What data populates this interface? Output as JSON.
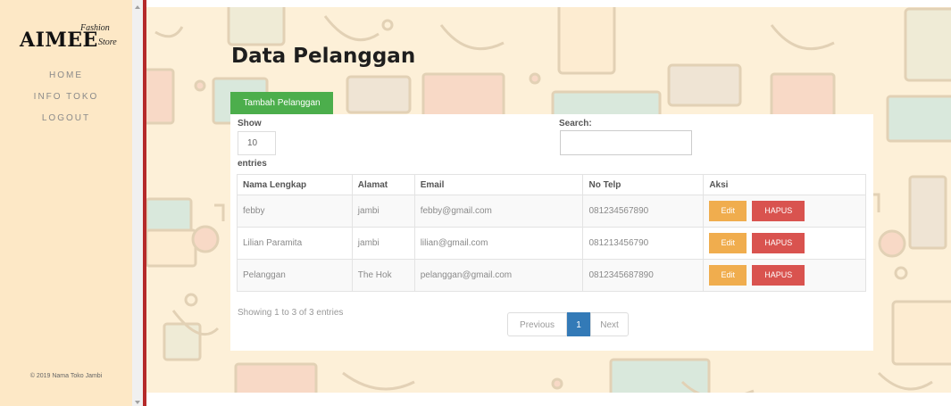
{
  "brand": {
    "main": "AIMEE",
    "script_top": "Fashion",
    "script_bottom": "Store"
  },
  "sidebar": {
    "items": [
      {
        "label": "HOME"
      },
      {
        "label": "INFO TOKO"
      },
      {
        "label": "LOGOUT"
      }
    ],
    "footer": "© 2019 Nama Toko Jambi"
  },
  "page": {
    "title": "Data Pelanggan",
    "add_button": "Tambah Pelanggan"
  },
  "table_controls": {
    "show_label": "Show",
    "length_value": "10",
    "entries_label": "entries",
    "search_label": "Search:",
    "search_value": ""
  },
  "table": {
    "headers": [
      "Nama Lengkap",
      "Alamat",
      "Email",
      "No Telp",
      "Aksi"
    ],
    "rows": [
      {
        "nama": "febby",
        "alamat": "jambi",
        "email": "febby@gmail.com",
        "telp": "081234567890"
      },
      {
        "nama": "Lilian Paramita",
        "alamat": "jambi",
        "email": "lilian@gmail.com",
        "telp": "081213456790"
      },
      {
        "nama": "Pelanggan",
        "alamat": "The Hok",
        "email": "pelanggan@gmail.com",
        "telp": "0812345687890"
      }
    ],
    "edit_label": "Edit",
    "delete_label": "HAPUS"
  },
  "footer_info": "Showing 1 to 3 of 3 entries",
  "pagination": {
    "previous": "Previous",
    "current": "1",
    "next": "Next"
  },
  "colors": {
    "sidebar_bg": "#fde8c6",
    "divider": "#b52a2a",
    "add_button": "#4cae4c",
    "edit_button": "#f0ad4e",
    "delete_button": "#d9534f",
    "page_active": "#337ab7"
  }
}
